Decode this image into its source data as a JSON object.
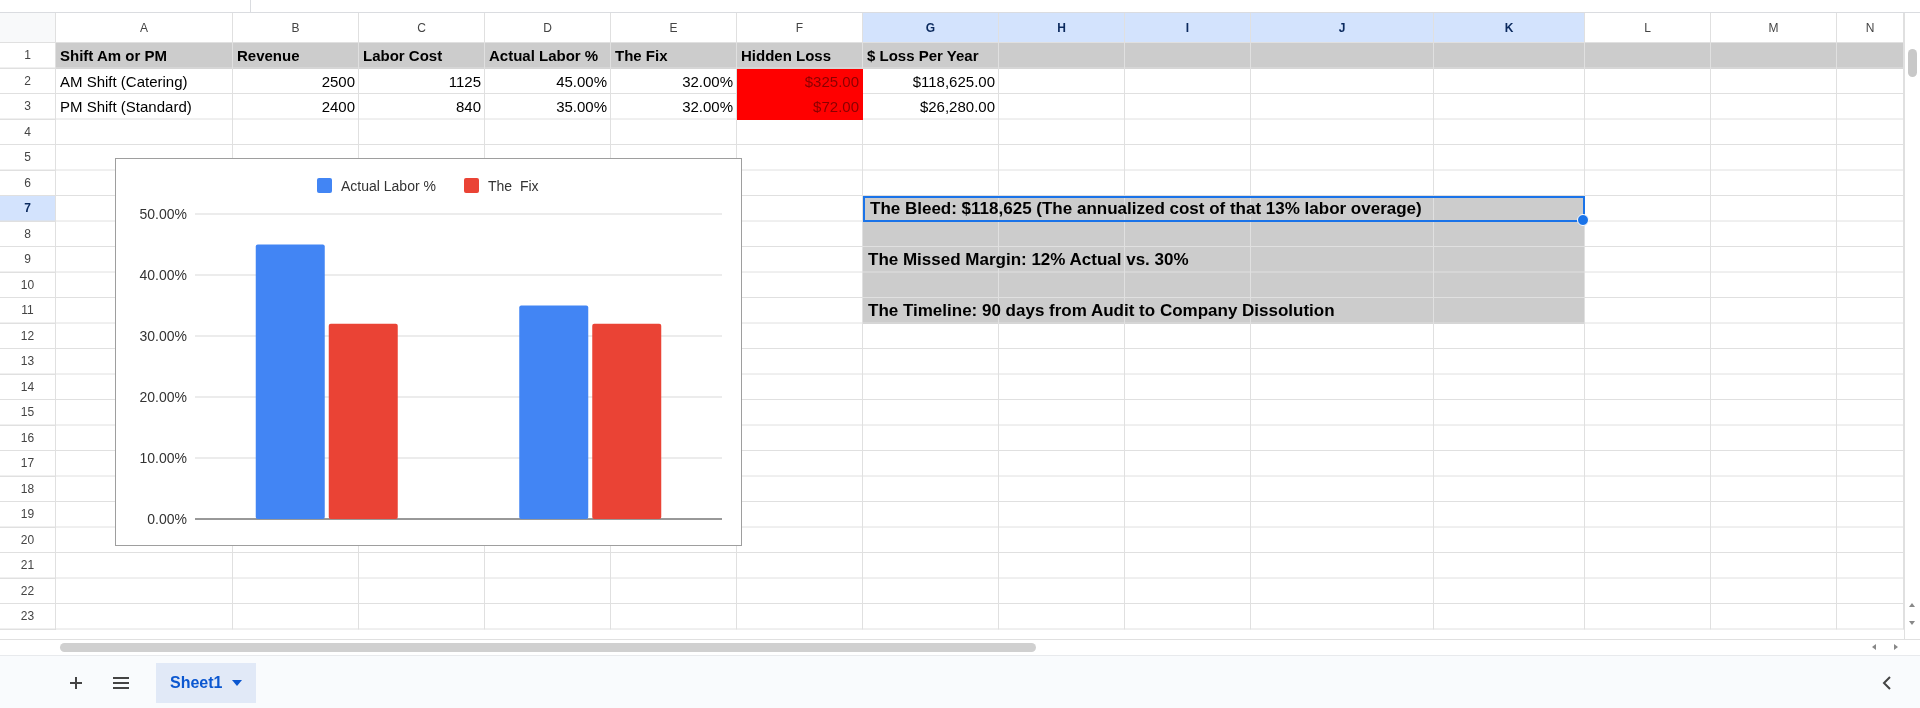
{
  "columns": [
    {
      "label": "A",
      "selected": false
    },
    {
      "label": "B",
      "selected": false
    },
    {
      "label": "C",
      "selected": false
    },
    {
      "label": "D",
      "selected": false
    },
    {
      "label": "E",
      "selected": false
    },
    {
      "label": "F",
      "selected": false
    },
    {
      "label": "G",
      "selected": true
    },
    {
      "label": "H",
      "selected": true
    },
    {
      "label": "I",
      "selected": true
    },
    {
      "label": "J",
      "selected": true
    },
    {
      "label": "K",
      "selected": true
    },
    {
      "label": "L",
      "selected": false
    },
    {
      "label": "M",
      "selected": false
    },
    {
      "label": "N",
      "selected": false
    }
  ],
  "rows": [
    {
      "label": "1",
      "selected": false,
      "kind": "header",
      "cells": [
        {
          "text": "Shift Am or PM",
          "kind": "text"
        },
        {
          "text": "Revenue",
          "kind": "text"
        },
        {
          "text": "Labor Cost",
          "kind": "text"
        },
        {
          "text": "Actual Labor %",
          "kind": "text"
        },
        {
          "text": "The  Fix",
          "kind": "text"
        },
        {
          "text": "Hidden Loss",
          "kind": "text"
        },
        {
          "text": "$ Loss Per Year",
          "kind": "text"
        }
      ]
    },
    {
      "label": "2",
      "selected": false,
      "kind": "data",
      "cells": [
        {
          "text": "AM Shift (Catering)",
          "kind": "text"
        },
        {
          "text": "2500",
          "kind": "number"
        },
        {
          "text": "1125",
          "kind": "number"
        },
        {
          "text": "45.00%",
          "kind": "number"
        },
        {
          "text": "32.00%",
          "kind": "number"
        },
        {
          "text": "$325.00",
          "kind": "number",
          "color": "#ff0000"
        },
        {
          "text": "$118,625.00",
          "kind": "number"
        }
      ]
    },
    {
      "label": "3",
      "selected": false,
      "kind": "data",
      "cells": [
        {
          "text": "PM Shift (Standard)",
          "kind": "text"
        },
        {
          "text": "2400",
          "kind": "number"
        },
        {
          "text": "840",
          "kind": "number"
        },
        {
          "text": "35.00%",
          "kind": "number"
        },
        {
          "text": "32.00%",
          "kind": "number"
        },
        {
          "text": "$72.00",
          "kind": "number",
          "color": "#ff0000"
        },
        {
          "text": "$26,280.00",
          "kind": "number"
        }
      ]
    },
    {
      "label": "4",
      "selected": false,
      "kind": "empty"
    },
    {
      "label": "5",
      "selected": false,
      "kind": "empty"
    },
    {
      "label": "6",
      "selected": false,
      "kind": "empty"
    },
    {
      "label": "7",
      "selected": true,
      "kind": "empty"
    },
    {
      "label": "8",
      "selected": false,
      "kind": "empty"
    },
    {
      "label": "9",
      "selected": false,
      "kind": "empty"
    },
    {
      "label": "10",
      "selected": false,
      "kind": "empty"
    },
    {
      "label": "11",
      "selected": false,
      "kind": "empty"
    },
    {
      "label": "12",
      "selected": false,
      "kind": "empty"
    },
    {
      "label": "13",
      "selected": false,
      "kind": "empty"
    },
    {
      "label": "14",
      "selected": false,
      "kind": "empty"
    },
    {
      "label": "15",
      "selected": false,
      "kind": "empty"
    },
    {
      "label": "16",
      "selected": false,
      "kind": "empty"
    },
    {
      "label": "17",
      "selected": false,
      "kind": "empty"
    },
    {
      "label": "18",
      "selected": false,
      "kind": "empty"
    },
    {
      "label": "19",
      "selected": false,
      "kind": "empty"
    },
    {
      "label": "20",
      "selected": false,
      "kind": "empty"
    },
    {
      "label": "21",
      "selected": false,
      "kind": "empty"
    },
    {
      "label": "22",
      "selected": false,
      "kind": "empty"
    },
    {
      "label": "23",
      "selected": false,
      "kind": "empty"
    }
  ],
  "notes": [
    {
      "text": "The Bleed: $118,625 (The annualized cost of that 13% labor overage)",
      "selected": true
    },
    {
      "text": "The Missed Margin: 12% Actual vs. 30%",
      "selected": false
    },
    {
      "text": "The Timeline: 90 days from Audit to Company Dissolution",
      "selected": false
    }
  ],
  "chart": {
    "chart_data": {
      "type": "bar",
      "grid": true,
      "legend": "top",
      "ylim": [
        0,
        0.5
      ],
      "yticks": [
        {
          "value": 0,
          "label": "0.00%"
        },
        {
          "value": 0.1,
          "label": "10.00%"
        },
        {
          "value": 0.2,
          "label": "20.00%"
        },
        {
          "value": 0.3,
          "label": "30.00%"
        },
        {
          "value": 0.4,
          "label": "40.00%"
        },
        {
          "value": 0.5,
          "label": "50.00%"
        }
      ],
      "series": [
        {
          "name": "Actual Labor %",
          "color": "#4285f4",
          "values": [
            0.45,
            0.35
          ]
        },
        {
          "name": "The  Fix",
          "color": "#ea4335",
          "values": [
            0.32,
            0.32
          ]
        }
      ]
    }
  },
  "sheet_tabs": [
    {
      "label": "Sheet1",
      "selected": true
    }
  ]
}
